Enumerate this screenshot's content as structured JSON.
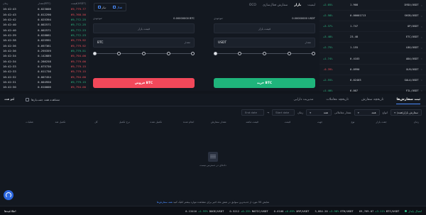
{
  "orderbook": {
    "headers": [
      "زمان",
      "مقدار(BTC)",
      "قیمت(USDT)"
    ],
    "rows": [
      {
        "time": "16:42:43",
        "amount": "0.023008",
        "price": "69,779.77",
        "dir": "dn"
      },
      {
        "time": "16:42:43",
        "amount": "0.012290",
        "price": "69,768.56",
        "dir": "dn"
      },
      {
        "time": "16:42:42",
        "amount": "0.025394",
        "price": "69,772.25",
        "dir": "up"
      },
      {
        "time": "16:42:40",
        "amount": "0.002571",
        "price": "69,772.25",
        "dir": "up"
      },
      {
        "time": "16:42:40",
        "amount": "0.002571",
        "price": "69,772.23",
        "dir": "up"
      },
      {
        "time": "16:42:39",
        "amount": "0.028861",
        "price": "69,772.23",
        "dir": "up"
      },
      {
        "time": "16:42:38",
        "amount": "0.025991",
        "price": "69,779.92",
        "dir": "dn"
      },
      {
        "time": "16:42:36",
        "amount": "0.097361",
        "price": "69,779.92",
        "dir": "dn"
      },
      {
        "time": "16:42:36",
        "amount": "0.295359",
        "price": "69,779.51",
        "dir": "up"
      },
      {
        "time": "16:42:34",
        "amount": "0.142889",
        "price": "69,794.00",
        "dir": "dn"
      },
      {
        "time": "16:42:34",
        "amount": "0.286258",
        "price": "69,779.00",
        "dir": "dn"
      },
      {
        "time": "16:42:33",
        "amount": "0.075730",
        "price": "69,779.15",
        "dir": "dn"
      },
      {
        "time": "16:42:33",
        "amount": "0.011736",
        "price": "69,779.15",
        "dir": "dn"
      },
      {
        "time": "16:42:32",
        "amount": "0.007454",
        "price": "69,794.00",
        "dir": "dn"
      },
      {
        "time": "16:42:31",
        "amount": "0.004950",
        "price": "69,779.15",
        "dir": "up"
      },
      {
        "time": "16:42:30",
        "amount": "0.010000",
        "price": "69,794.00",
        "dir": "dn"
      }
    ]
  },
  "trade": {
    "tabs": [
      "لیمیت",
      "بازار",
      "سفارش فعال‌سازی",
      "OCO"
    ],
    "active_tab": "بازار",
    "mode": {
      "maker": "تیکر",
      "taker": "فعال"
    },
    "buy": {
      "balance_label": "موجودی:",
      "balance": "0.00000000 USDT",
      "price_placeholder": "قیمت بازار",
      "amount_label": "مقدار",
      "currency": "USDT",
      "button": "خرید BTC"
    },
    "sell": {
      "balance_label": "موجودی:",
      "balance": "0.00000000 BTC",
      "price_placeholder": "قیمت بازار",
      "amount_label": "مقدار",
      "currency": "BTC",
      "button": "فروش BTC"
    }
  },
  "markets": [
    {
      "symbol": "DYDX/USDT",
      "price": "1.908",
      "change": "+2.05%",
      "dir": "up"
    },
    {
      "symbol": "SHIB/USDT",
      "price": "0.00001713",
      "change": "+2.58%",
      "dir": "up"
    },
    {
      "symbol": "OP/USDT",
      "price": "1.747",
      "change": "+3.37%",
      "dir": "up"
    },
    {
      "symbol": "ETC/USDT",
      "price": "23.48",
      "change": "+3.48%",
      "dir": "up"
    },
    {
      "symbol": "LDO/USDT",
      "price": "1.155",
      "change": "+2.75%",
      "dir": "up"
    },
    {
      "symbol": "ADA/USDT",
      "price": "0.4183",
      "change": "+1.74%",
      "dir": "up"
    },
    {
      "symbol": "XLM/USDT",
      "price": "0.0990",
      "change": "-0.39%",
      "dir": "dn"
    },
    {
      "symbol": "GALA/USDT",
      "price": "0.02403",
      "change": "+2.55%",
      "dir": "up"
    },
    {
      "symbol": "FIL/USDT",
      "price": "6.007",
      "change": "+1.40%",
      "dir": "up"
    }
  ],
  "orders": {
    "tabs": [
      "ثبت سفارش‌ها",
      "تاریخچه سفارش",
      "تاریخچه معاملات",
      "مدیریت دارایی"
    ],
    "active_tab": "ثبت سفارش‌ها",
    "show_all": "مشاهده همه جفت‌بازها",
    "cancel_all": "لغو همه",
    "filters": {
      "pair_label": "سفارش بازار(همه)",
      "pair_value": "بازار",
      "type_label": "انواع",
      "type_value": "همه",
      "side_label": "مقدار معاملاتی",
      "side_value": "همه",
      "time_label": "زمان",
      "start_date": "Start date",
      "end_date": "End date"
    },
    "columns": [
      "زمان",
      "جفت بازار",
      "نوع",
      "جهت",
      "قیمت",
      "قیمت ماشه",
      "مقدار سفارش",
      "انجام شده",
      "تکمیل شده",
      "نرخ تکمیل",
      "کل",
      "تکمیل شد",
      "عملیات"
    ],
    "empty_text": "داده‌ای در دسترس نیست",
    "notice": "نمایش 50 مورد از جدیدترین سوابق در شش ماه اخیر برای مشاهده موارد بیشتر کلیک کنید",
    "notice_link": "همه سفارش‌ها"
  },
  "ticker": {
    "left_label": "اطلاعیه‌ها",
    "connection": "اتصال پایدار",
    "items": [
      {
        "symbol": "BTC/USDT",
        "change": "+3.11%",
        "price": "69,769.07"
      },
      {
        "symbol": "ETH/USDT",
        "change": "+3.98%",
        "price": "3,884.20"
      },
      {
        "symbol": "XRP/USDT",
        "change": "+0.69%",
        "price": "0.6108"
      },
      {
        "symbol": "MATIC/USDT",
        "change": "+0.25%",
        "price": "0.5212"
      },
      {
        "symbol": "DOGE/USDT",
        "change": "+1.99%",
        "price": "0.13416"
      }
    ]
  },
  "colors": {
    "up": "#2dbd85",
    "down": "#f0505a",
    "accent": "#4a8cff",
    "buy": "#1fb47b",
    "sell": "#f2485a"
  }
}
